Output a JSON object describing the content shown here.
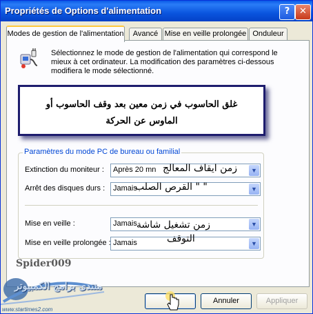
{
  "window": {
    "title": "Propriétés de Options d'alimentation",
    "help_symbol": "?",
    "close_symbol": "✕"
  },
  "tabs": [
    {
      "label": "Modes de gestion de l'alimentation",
      "active": true
    },
    {
      "label": "Avancé",
      "active": false
    },
    {
      "label": "Mise en veille prolongée",
      "active": false
    },
    {
      "label": "Onduleur",
      "active": false
    }
  ],
  "description": "Sélectionnez le mode de gestion de l'alimentation qui correspond le mieux à cet ordinateur. La modification des paramètres ci-dessous modifiera le mode sélectionné.",
  "banner": {
    "line1": "غلق الحاسوب في زمن معين بعد وقف الحاسوب أو",
    "line2": "الماوس عن الحركة"
  },
  "group": {
    "legend": "Paramètres du mode PC de bureau ou familial",
    "rows": [
      {
        "label": "Extinction du moniteur :",
        "value": "Après 20 mn"
      },
      {
        "label": "Arrêt des disques durs :",
        "value": "Jamais"
      },
      {
        "label": "Mise en veille :",
        "value": "Jamais"
      },
      {
        "label": "Mise en veille prolongée :",
        "value": "Jamais"
      }
    ]
  },
  "annotations": {
    "monitor": "زمن ايقاف المعالج",
    "disk": "\"  \"   القرص الصلب",
    "standby_line1": "زمن تشغيل شاشة",
    "standby_line2": "التوقف"
  },
  "watermark": "Spider009",
  "logo": {
    "text": "منتدى برامج الكمبيوتر",
    "url": "www.startimes2.com"
  },
  "buttons": {
    "ok": "",
    "cancel": "Annuler",
    "apply": "Appliquer"
  },
  "colors": {
    "titlebar": "#0a55de",
    "legend": "#0046d5",
    "active_tab_accent": "#ffc83c"
  }
}
